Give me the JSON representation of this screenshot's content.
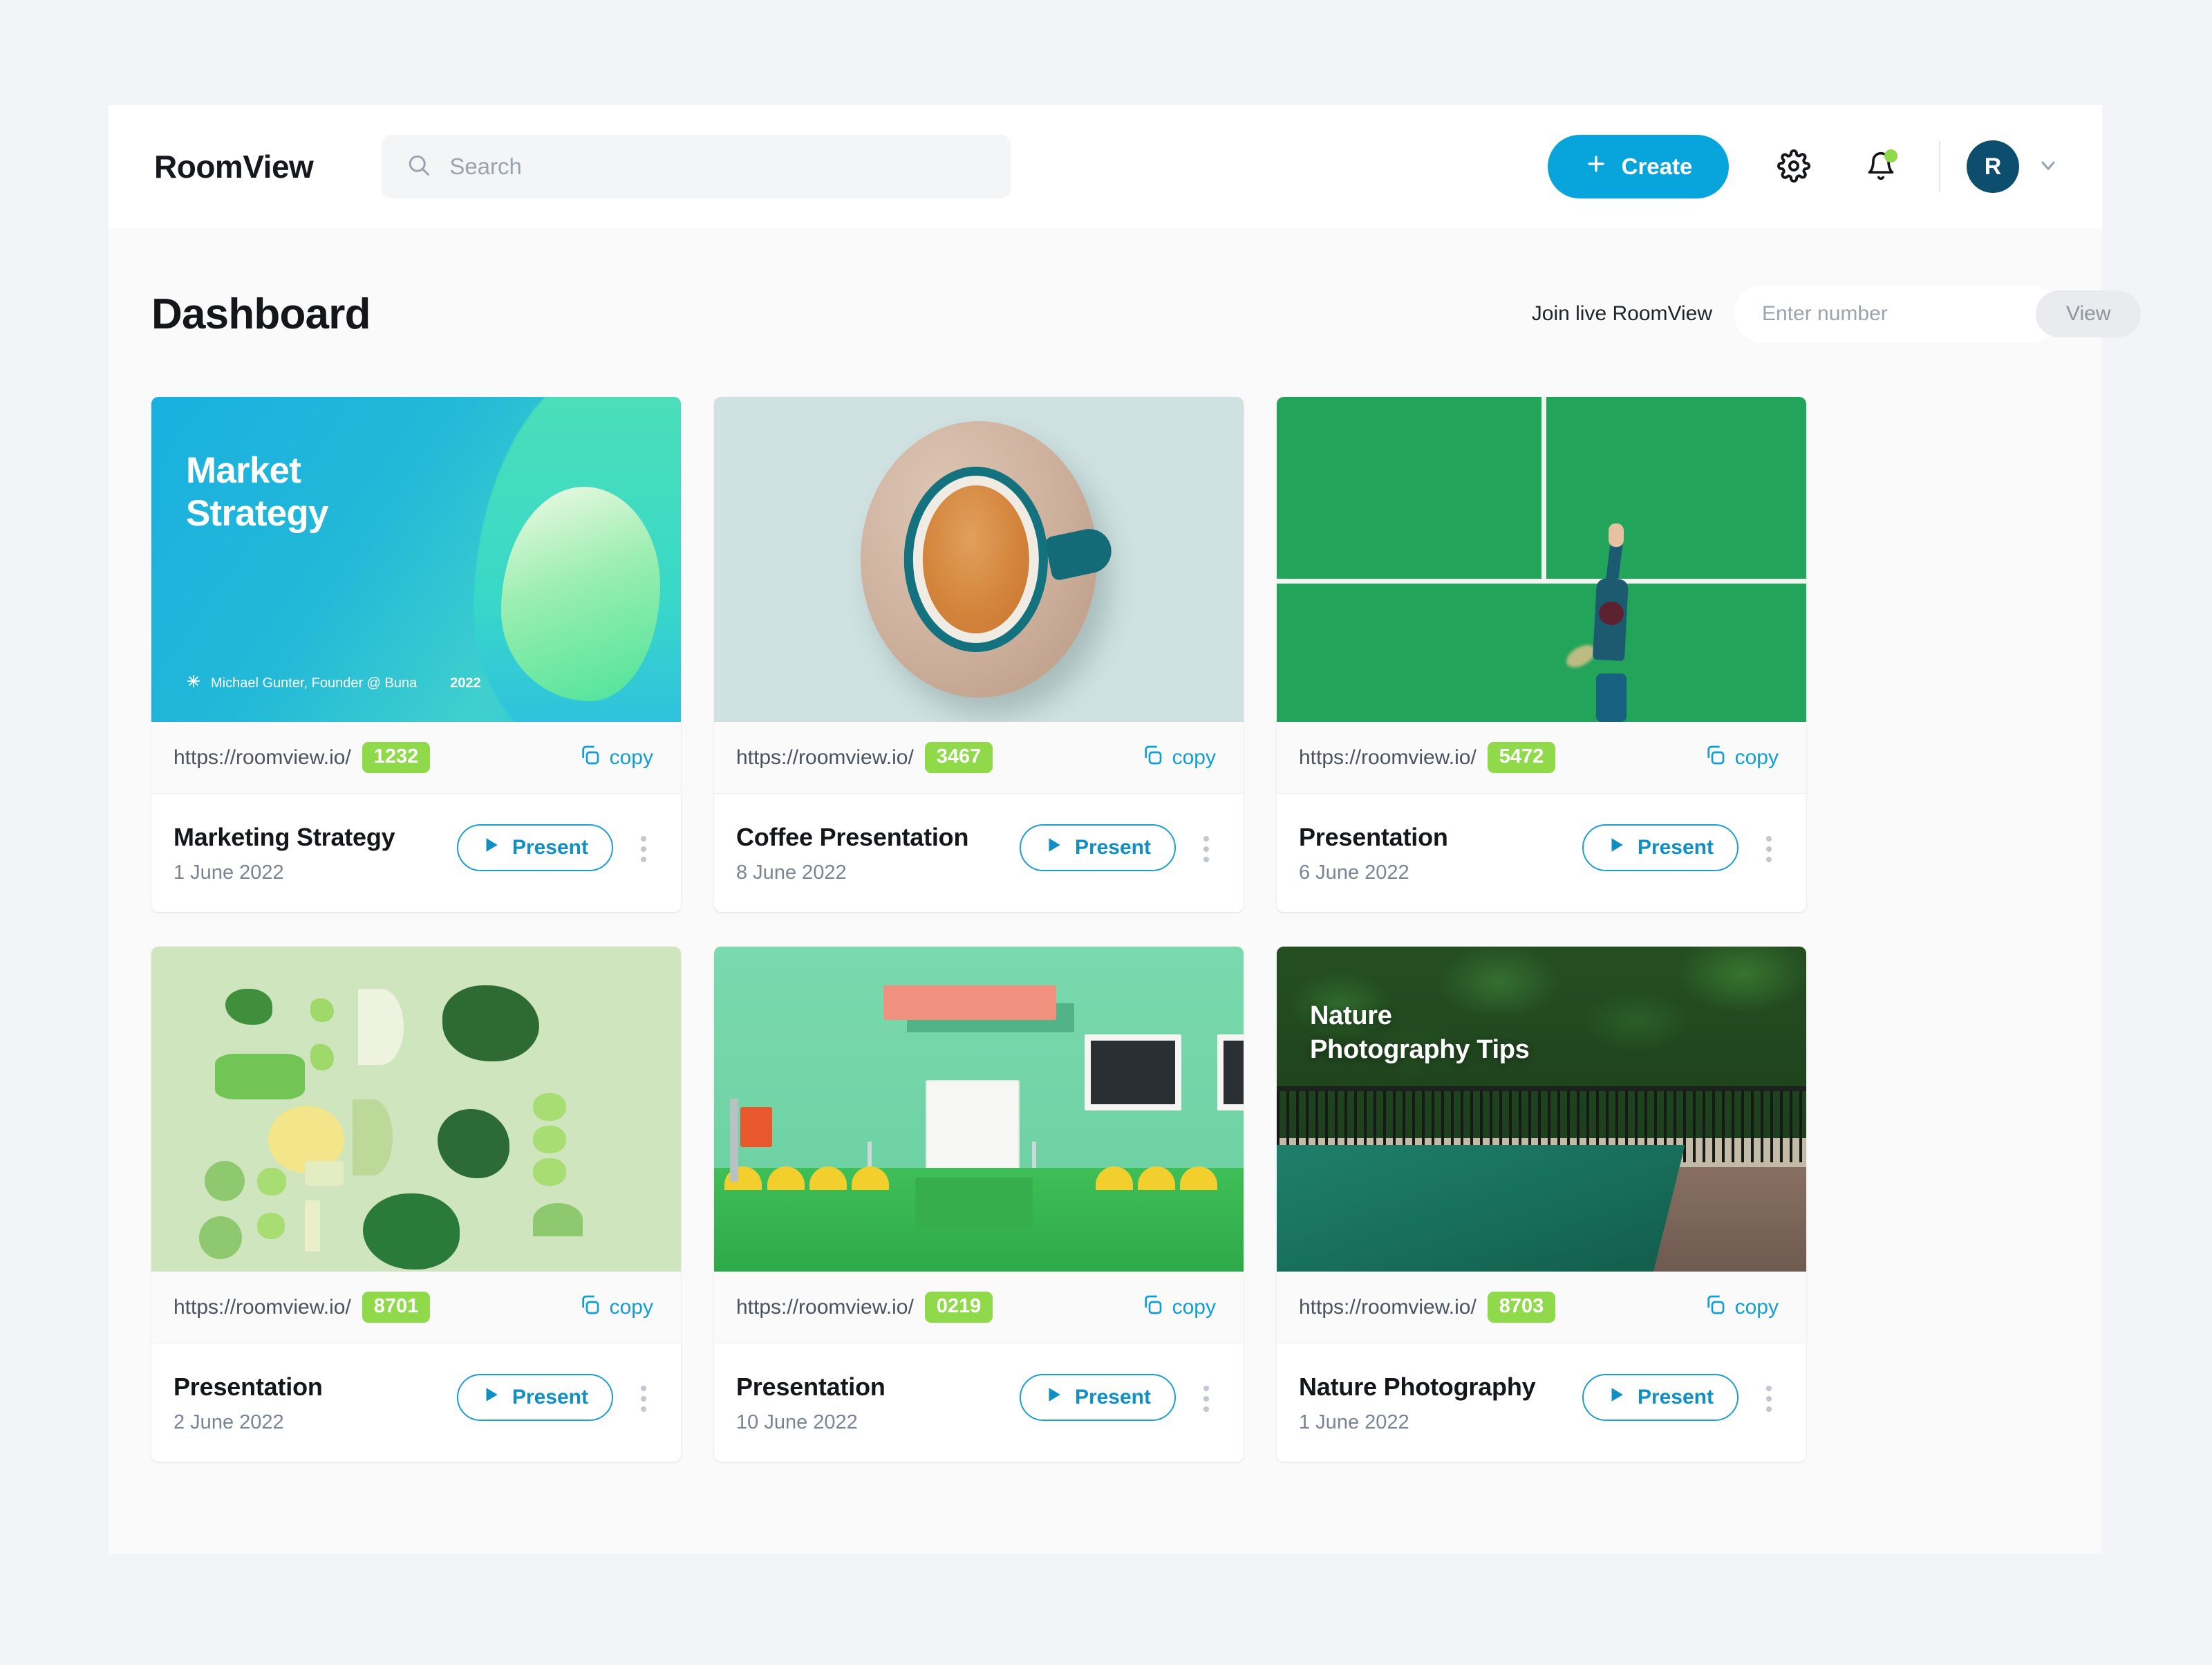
{
  "header": {
    "brand": "RoomView",
    "search_placeholder": "Search",
    "create_label": "Create",
    "gear_icon": "gear-icon",
    "bell_icon": "bell-icon",
    "avatar_initial": "R",
    "chevron_icon": "chevron-down-icon",
    "accent_color": "#08a5dc",
    "avatar_color": "#0d4d6e",
    "notification_dot_color": "#8fd94a"
  },
  "page": {
    "title": "Dashboard",
    "join_label": "Join live RoomView",
    "join_placeholder": "Enter number",
    "join_value": "",
    "view_label": "View"
  },
  "common": {
    "copy_label": "copy",
    "present_label": "Present",
    "url_prefix": "https://roomview.io/",
    "chip_color": "#8fd94a",
    "present_color": "#0f8fc4"
  },
  "cards": [
    {
      "url": "https://roomview.io/",
      "code": "1232",
      "title": "Marketing Strategy",
      "date": "1 June 2022",
      "thumb_kind": "market-strategy-slide",
      "slide": {
        "heading_line1": "Market",
        "heading_line2": "Strategy",
        "author": "Michael Gunter, Founder @ Buna",
        "year": "2022"
      }
    },
    {
      "url": "https://roomview.io/",
      "code": "3467",
      "title": "Coffee Presentation",
      "date": "8 June 2022",
      "thumb_kind": "coffee-cup-photo"
    },
    {
      "url": "https://roomview.io/",
      "code": "5472",
      "title": "Presentation",
      "date": "6 June 2022",
      "thumb_kind": "tennis-court-photo"
    },
    {
      "url": "https://roomview.io/",
      "code": "8701",
      "title": "Presentation",
      "date": "2 June 2022",
      "thumb_kind": "green-vegetables-photo"
    },
    {
      "url": "https://roomview.io/",
      "code": "0219",
      "title": "Presentation",
      "date": "10 June 2022",
      "thumb_kind": "mint-house-photo"
    },
    {
      "url": "https://roomview.io/",
      "code": "8703",
      "title": "Nature Photography",
      "date": "1 June 2022",
      "thumb_kind": "pool-jungle-photo",
      "overlay_line1": "Nature",
      "overlay_line2": "Photography Tips"
    }
  ]
}
